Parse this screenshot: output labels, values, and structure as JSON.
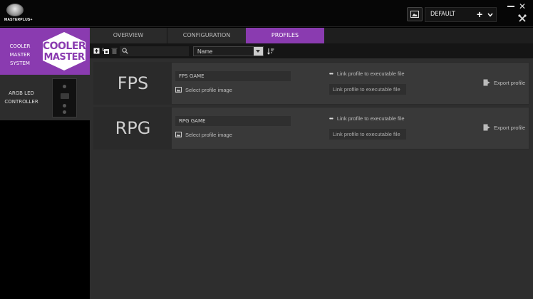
{
  "app": {
    "logo_text": "MASTERPLUS+"
  },
  "header": {
    "current_profile": "DEFAULT",
    "add_label": "+",
    "close_label": "✕"
  },
  "sidebar": {
    "devices": [
      {
        "label": "COOLER MASTER SYSTEM",
        "logo_line1": "COOLER",
        "logo_line2": "MASTER"
      },
      {
        "label": "ARGB LED CONTROLLER"
      }
    ]
  },
  "tabs": [
    {
      "label": "OVERVIEW"
    },
    {
      "label": "CONFIGURATION"
    },
    {
      "label": "PROFILES"
    }
  ],
  "toolbar": {
    "search_placeholder": "",
    "sort_value": "Name"
  },
  "profiles": [
    {
      "thumb_label": "FPS",
      "name": "FPS GAME",
      "select_image": "Select profile image",
      "link_label": "Link profile to executable file",
      "exe_placeholder": "Link profile to executable file",
      "export_label": "Export profile"
    },
    {
      "thumb_label": "RPG",
      "name": "RPG GAME",
      "select_image": "Select profile image",
      "link_label": "Link profile to executable file",
      "exe_placeholder": "Link profile to executable file",
      "export_label": "Export profile"
    }
  ],
  "colors": {
    "accent": "#8a3bb0",
    "panel": "#393939",
    "background": "#2e2e2e"
  },
  "icons": [
    "image-icon",
    "chevron-down-icon",
    "minimize-icon",
    "close-icon",
    "tools-icon",
    "add-icon",
    "import-icon",
    "delete-icon",
    "search-icon",
    "sort-icon",
    "picture-icon",
    "more-icon",
    "export-icon"
  ]
}
